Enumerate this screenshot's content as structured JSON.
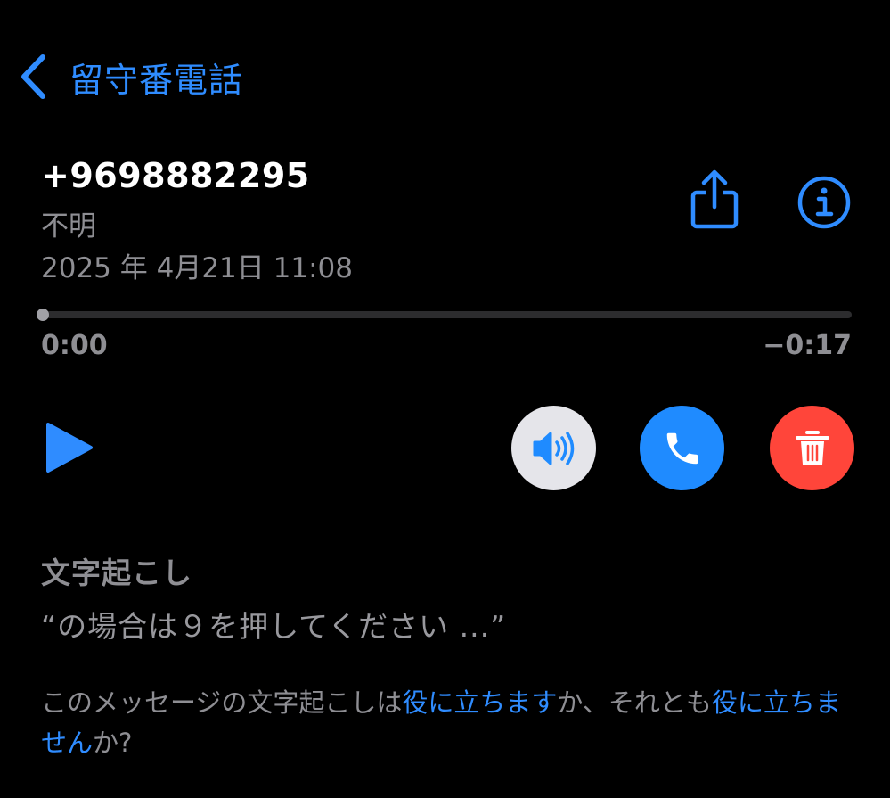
{
  "nav": {
    "back_label": "留守番電話",
    "icon": "chevron-left-icon"
  },
  "message": {
    "phone_number": "+9698882295",
    "caller_label": "不明",
    "datetime": "2025 年 4月21日 11:08"
  },
  "actions": {
    "share_icon": "share-icon",
    "info_icon": "info-icon"
  },
  "playback": {
    "progress": 0.0,
    "elapsed": "0:00",
    "remaining": "−0:17",
    "play_icon": "play-icon"
  },
  "controls": {
    "speaker_icon": "speaker-icon",
    "call_icon": "phone-icon",
    "delete_icon": "trash-icon"
  },
  "transcript": {
    "title": "文字起こし",
    "text": "“の場合は９を押してください ...”"
  },
  "feedback": {
    "prefix": "このメッセージの文字起こしは",
    "helpful_link": "役に立ちます",
    "middle": "か、それとも",
    "not_helpful_link": "役に立ちません",
    "suffix": "か?"
  },
  "colors": {
    "accent": "#2f8cff",
    "secondary_text": "#8e8e93",
    "speaker_bg": "#e5e5ea",
    "call_bg": "#1f8bff",
    "delete_bg": "#ff453a",
    "background": "#000000"
  }
}
